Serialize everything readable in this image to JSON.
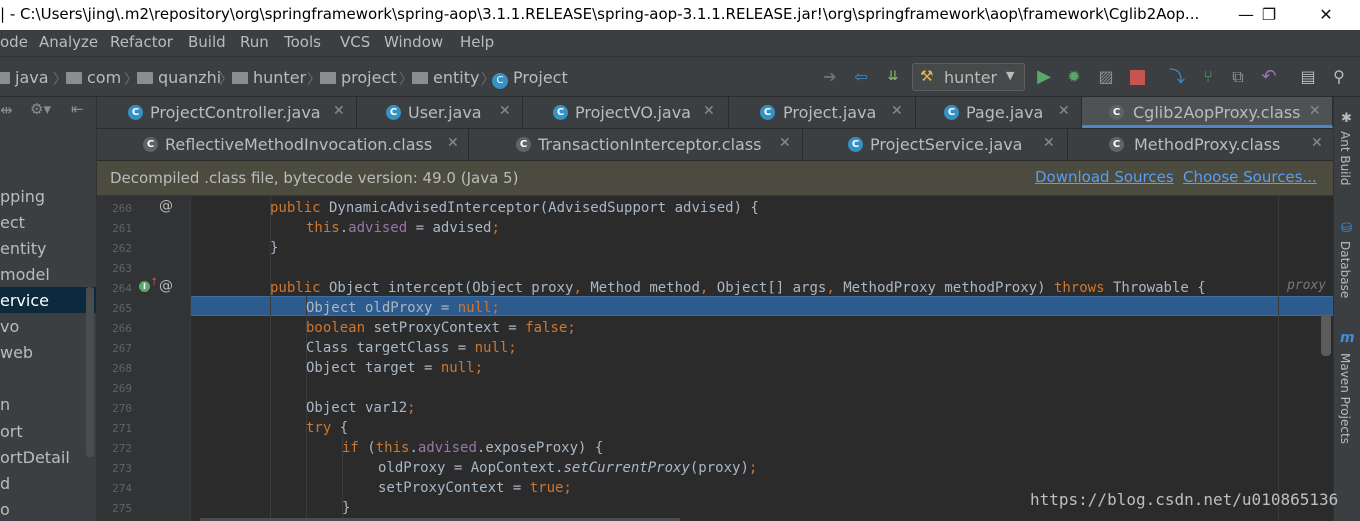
{
  "window": {
    "title": "| - C:\\Users\\jing\\.m2\\repository\\org\\springframework\\spring-aop\\3.1.1.RELEASE\\spring-aop-3.1.1.RELEASE.jar!\\org\\springframework\\aop\\framework\\Cglib2Aop...",
    "controls": [
      "—",
      "❐",
      "✕"
    ]
  },
  "menu": [
    "ode",
    "Analyze",
    "Refactor",
    "Build",
    "Run",
    "Tools",
    "VCS",
    "Window",
    "Help"
  ],
  "breadcrumb": [
    "java",
    "com",
    "quanzhi",
    "hunter",
    "project",
    "entity",
    "Project"
  ],
  "toolbar": {
    "run_config": "hunter",
    "icons": [
      "back-arrow-icon",
      "forward-arrow-icon",
      "sort-icon",
      "run-icon",
      "debug-icon",
      "coverage-icon",
      "stop-icon",
      "vcs-update-icon",
      "vcs-branch-icon",
      "vcs-commit-icon",
      "undo-icon",
      "structure-icon",
      "search-icon"
    ]
  },
  "left_panel": {
    "items": [
      "pping",
      "ect",
      "entity",
      "model",
      "ervice",
      "vo",
      "web",
      "n",
      "ort",
      "ortDetail",
      "d",
      "o"
    ],
    "selected_index": 4
  },
  "tabs_row1": [
    {
      "label": "ProjectController.java"
    },
    {
      "label": "User.java"
    },
    {
      "label": "ProjectVO.java"
    },
    {
      "label": "Project.java"
    },
    {
      "label": "Page.java"
    },
    {
      "label": "Cglib2AopProxy.class",
      "active": true
    }
  ],
  "tabs_row2": [
    {
      "label": "ReflectiveMethodInvocation.class"
    },
    {
      "label": "TransactionInterceptor.class"
    },
    {
      "label": "ProjectService.java"
    },
    {
      "label": "MethodProxy.class"
    }
  ],
  "banner": {
    "message": "Decompiled .class file, bytecode version: 49.0 (Java 5)",
    "download_sources": "Download Sources",
    "choose_sources": "Choose Sources..."
  },
  "editor": {
    "line_numbers": [
      "260",
      "261",
      "262",
      "263",
      "264",
      "265",
      "266",
      "267",
      "268",
      "269",
      "270",
      "271",
      "272",
      "273",
      "274",
      "275"
    ],
    "highlighted_line": "265"
  },
  "right_strip": [
    "Ant Build",
    "Database",
    "Maven Projects"
  ],
  "watermark": "https://blog.csdn.net/u010865136",
  "colors": {
    "keyword": "#cc7832",
    "field": "#9876aa",
    "selection": "#2d5b8d",
    "link": "#589df6"
  }
}
